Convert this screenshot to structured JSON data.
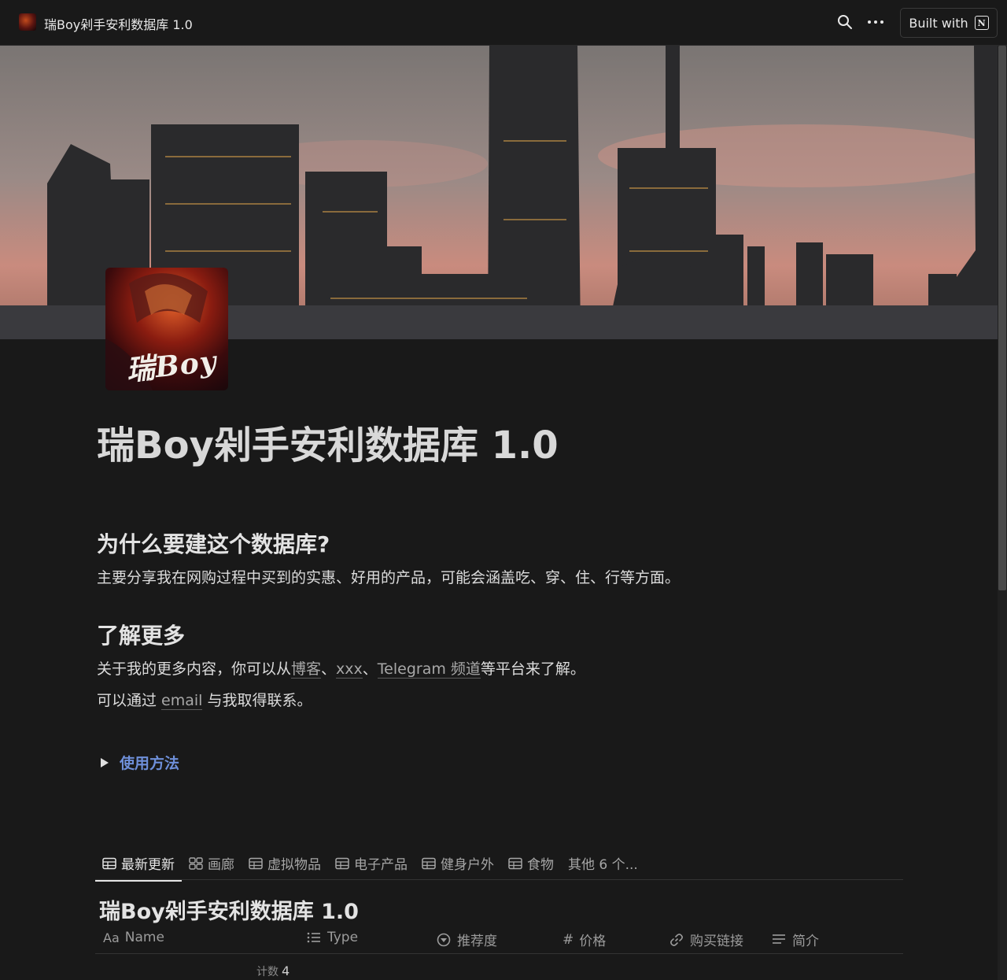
{
  "topbar": {
    "title": "瑞Boy剁手安利数据库 1.0",
    "built_with": "Built with",
    "icons": [
      "search-icon",
      "more-icon",
      "notion-icon"
    ]
  },
  "avatar": {
    "text": "瑞Boy"
  },
  "page": {
    "title": "瑞Boy剁手安利数据库 1.0",
    "why_heading": "为什么要建这个数据库?",
    "why_text": "主要分享我在网购过程中买到的实惠、好用的产品，可能会涵盖吃、穿、住、行等方面。",
    "more_heading": "了解更多",
    "more_text_prefix": "关于我的更多内容，你可以从",
    "link_blog": "博客",
    "sep1": "、",
    "link_xxx": "xxx",
    "sep2": "、",
    "link_telegram": "Telegram 频道",
    "more_text_suffix": "等平台来了解。",
    "contact_prefix": "可以通过 ",
    "link_email": "email",
    "contact_suffix": " 与我取得联系。",
    "toggle_label": "使用方法"
  },
  "tabs": [
    {
      "label": "最新更新",
      "icon": "table-icon",
      "active": true
    },
    {
      "label": "画廊",
      "icon": "gallery-icon"
    },
    {
      "label": "虚拟物品",
      "icon": "table-icon"
    },
    {
      "label": "电子产品",
      "icon": "table-icon"
    },
    {
      "label": "健身户外",
      "icon": "table-icon"
    },
    {
      "label": "食物",
      "icon": "table-icon"
    },
    {
      "label": "其他 6 个..."
    }
  ],
  "database": {
    "title": "瑞Boy剁手安利数据库 1.0",
    "columns": [
      {
        "label": "Name",
        "icon": "Aa"
      },
      {
        "label": "Type",
        "icon": "list-icon"
      },
      {
        "label": "推荐度",
        "icon": "status-icon"
      },
      {
        "label": "价格",
        "icon": "#"
      },
      {
        "label": "购买链接",
        "icon": "link-icon"
      },
      {
        "label": "简介",
        "icon": "text-icon"
      }
    ],
    "count_label": "计数",
    "count_value": "4"
  }
}
